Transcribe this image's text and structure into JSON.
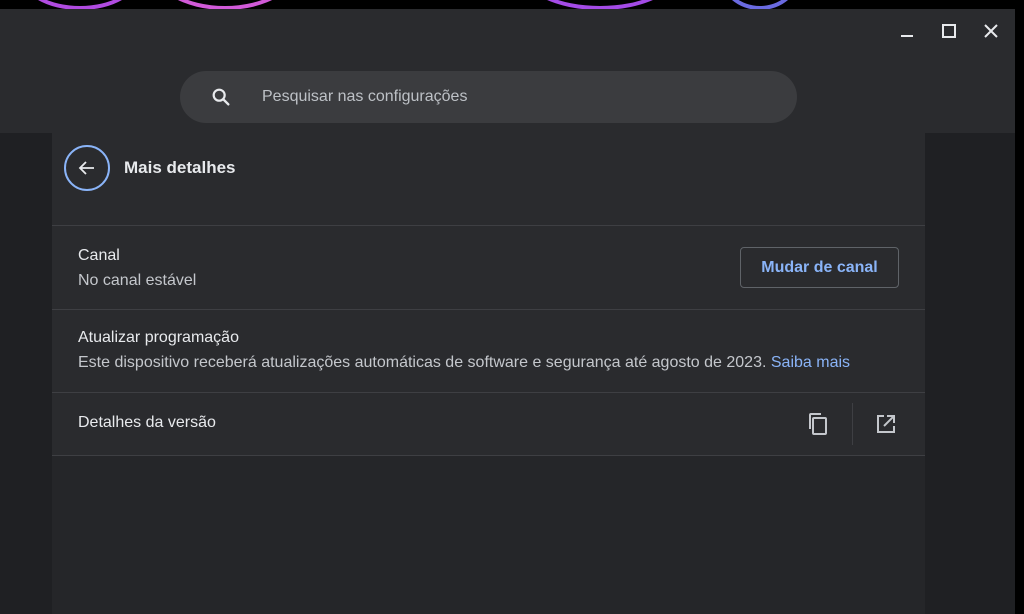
{
  "window": {
    "minimize_icon": "minimize-icon",
    "maximize_icon": "maximize-icon",
    "close_icon": "close-icon"
  },
  "search": {
    "icon": "search-icon",
    "placeholder": "Pesquisar nas configurações"
  },
  "page": {
    "back_icon": "arrow-left-icon",
    "title": "Mais detalhes"
  },
  "channel": {
    "title": "Canal",
    "status": "No canal estável",
    "button_label": "Mudar de canal"
  },
  "update_schedule": {
    "title": "Atualizar programação",
    "description": "Este dispositivo receberá atualizações automáticas de software e segurança até agosto de 2023.",
    "link_label": "Saiba mais"
  },
  "build_details": {
    "title": "Detalhes da versão",
    "copy_icon": "copy-icon",
    "open_icon": "open-in-new-icon"
  },
  "colors": {
    "accent": "#8ab4f8",
    "background": "#1f2023",
    "surface": "#2a2b2e",
    "text": "#e8eaed"
  }
}
